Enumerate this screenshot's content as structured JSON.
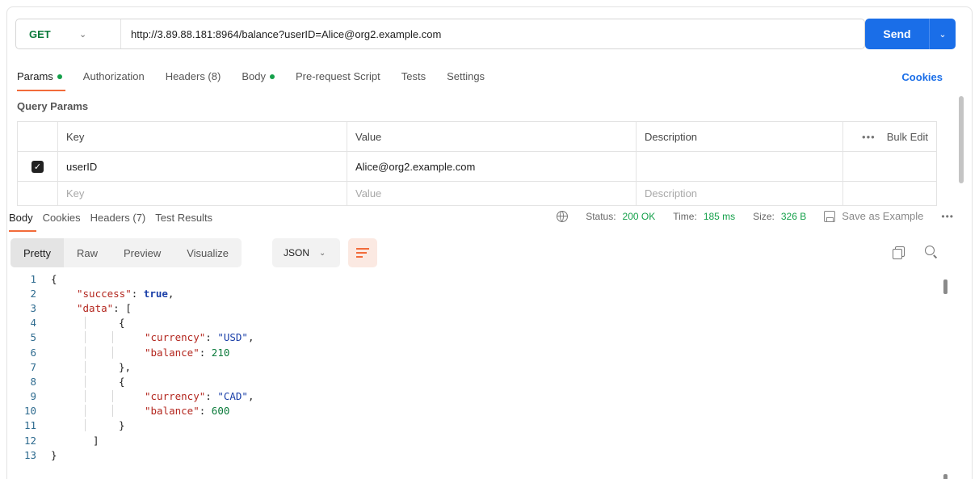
{
  "request": {
    "method": "GET",
    "url": "http://3.89.88.181:8964/balance?userID=Alice@org2.example.com",
    "send_label": "Send"
  },
  "request_tabs": [
    "Params",
    "Authorization",
    "Headers (8)",
    "Body",
    "Pre-request Script",
    "Tests",
    "Settings"
  ],
  "cookies_link": "Cookies",
  "query_params": {
    "title": "Query Params",
    "headers": {
      "key": "Key",
      "value": "Value",
      "description": "Description",
      "bulk_edit": "Bulk Edit",
      "more": "•••"
    },
    "rows": [
      {
        "checked": true,
        "key": "userID",
        "value": "Alice@org2.example.com",
        "description": ""
      }
    ],
    "placeholder": {
      "key": "Key",
      "value": "Value",
      "description": "Description"
    }
  },
  "response_tabs": [
    "Body",
    "Cookies",
    "Headers (7)",
    "Test Results"
  ],
  "status": {
    "status_label": "Status:",
    "status_value": "200 OK",
    "time_label": "Time:",
    "time_value": "185 ms",
    "size_label": "Size:",
    "size_value": "326 B",
    "save_example": "Save as Example",
    "more": "•••"
  },
  "view_modes": [
    "Pretty",
    "Raw",
    "Preview",
    "Visualize"
  ],
  "format": "JSON",
  "code_lines": [
    "1",
    "2",
    "3",
    "4",
    "5",
    "6",
    "7",
    "8",
    "9",
    "10",
    "11",
    "12",
    "13"
  ],
  "json_body": {
    "success_key": "\"success\"",
    "success_val": "true",
    "data_key": "\"data\"",
    "currency_key": "\"currency\"",
    "balance_key": "\"balance\"",
    "items": [
      {
        "currency": "\"USD\"",
        "balance": "210"
      },
      {
        "currency": "\"CAD\"",
        "balance": "600"
      }
    ]
  },
  "colors": {
    "accent": "#1a6ee8",
    "tab_underline": "#f26b3a",
    "ok": "#14a04a"
  }
}
